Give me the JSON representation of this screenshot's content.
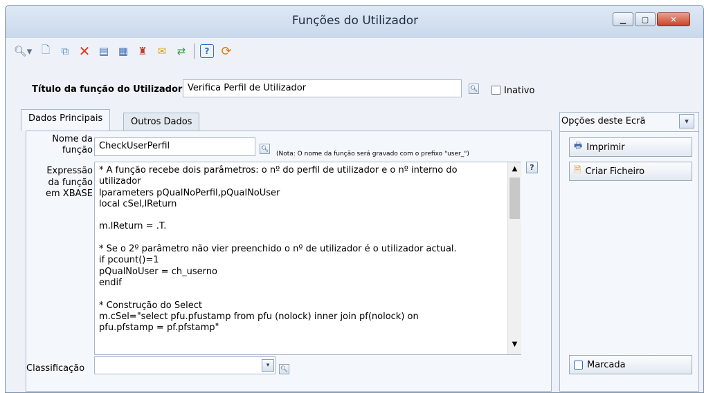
{
  "window": {
    "title": "Funções do Utilizador"
  },
  "toolbar": {
    "items": [
      "search-icon",
      "new-document-icon",
      "copy-document-icon",
      "delete-icon",
      "edit-icon",
      "grid-icon",
      "hierarchy-icon",
      "email-icon",
      "transfer-icon",
      "help-icon",
      "refresh-icon"
    ]
  },
  "form": {
    "title_label": "Título da função do Utilizador",
    "title_value": "Verifica Perfil de Utilizador",
    "inactive_label": "Inativo",
    "inactive_checked": false
  },
  "tabs": [
    {
      "label": "Dados Principais",
      "active": true
    },
    {
      "label": "Outros Dados",
      "active": false
    }
  ],
  "main": {
    "name_label": "Nome da\nfunção",
    "name_value": "CheckUserPerfil",
    "name_note": "(Nota: O nome da função será gravado com o prefixo \"user_\")",
    "expr_label": "Expressão\nda função\nem XBASE",
    "expr_value": "* A função recebe dois parâmetros: o nº do perfil de utilizador e o nº interno do\nutilizador\nlparameters pQualNoPerfil,pQualNoUser\nlocal cSel,lReturn\n\nm.lReturn = .T.\n\n* Se o 2º parâmetro não vier preenchido o nº de utilizador é o utilizador actual.\nif pcount()=1\npQualNoUser = ch_userno\nendif\n\n* Construção do Select\nm.cSel=\"select pfu.pfustamp from pfu (nolock) inner join pf(nolock) on\npfu.pfstamp = pf.pfstamp\"",
    "help_label": "?",
    "classification_label": "Classificação",
    "classification_value": ""
  },
  "side": {
    "dropdown_label": "Opções deste Ecrã",
    "buttons": [
      {
        "label": "Imprimir",
        "icon": "printer-icon"
      },
      {
        "label": "Criar Ficheiro",
        "icon": "file-icon"
      }
    ],
    "bottom_button": {
      "label": "Marcada",
      "icon": "checkbox-icon"
    }
  }
}
